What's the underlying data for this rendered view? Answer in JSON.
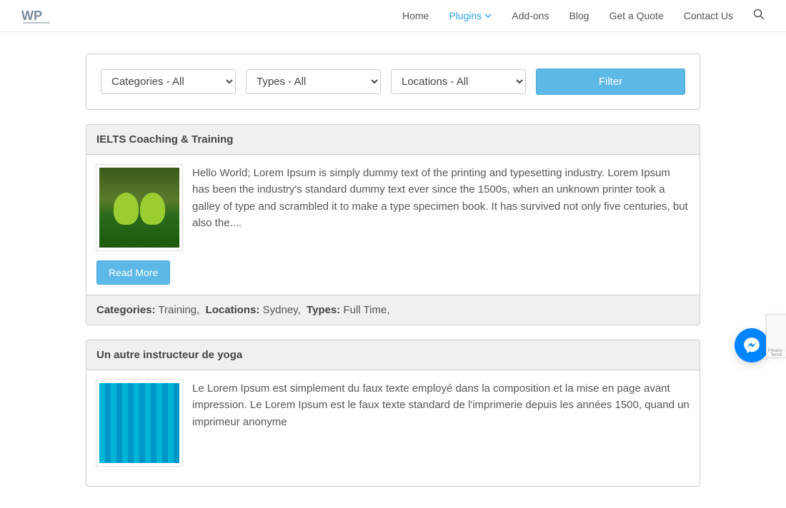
{
  "nav": {
    "home": "Home",
    "plugins": "Plugins",
    "addons": "Add-ons",
    "blog": "Blog",
    "quote": "Get a Quote",
    "contact": "Contact Us"
  },
  "filters": {
    "categories": "Categories - All",
    "types": "Types - All",
    "locations": "Locations - All",
    "button": "Filter"
  },
  "listings": [
    {
      "title": "IELTS Coaching & Training",
      "excerpt": "Hello World; Lorem Ipsum is simply dummy text of the printing and typesetting industry. Lorem Ipsum has been the industry's standard dummy text ever since the 1500s, when an unknown printer took a galley of type and scrambled it to make a type specimen book. It has survived not only five centuries, but also the....",
      "read_more": "Read More",
      "meta": {
        "categories_label": "Categories:",
        "categories_value": "Training,",
        "locations_label": "Locations:",
        "locations_value": "Sydney,",
        "types_label": "Types:",
        "types_value": "Full Time,"
      }
    },
    {
      "title": "Un autre instructeur de yoga",
      "excerpt": "Le Lorem Ipsum est simplement du faux texte employé dans la composition et la mise en page avant impression. Le Lorem Ipsum est le faux texte standard de l'imprimerie depuis les années 1500, quand un imprimeur anonyme"
    }
  ],
  "recaptcha": "Privacy - Terms"
}
